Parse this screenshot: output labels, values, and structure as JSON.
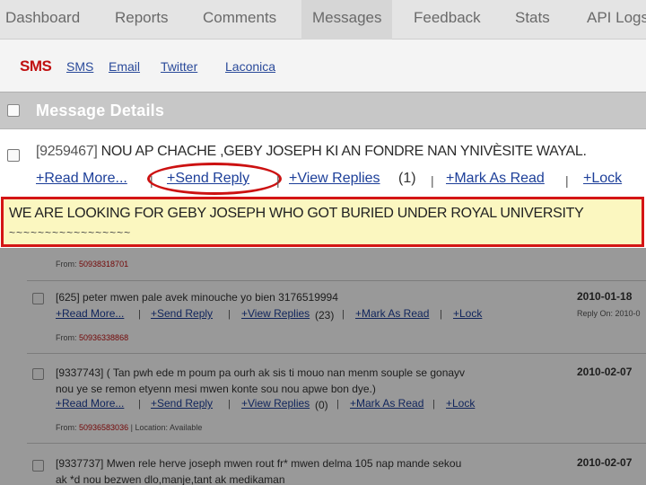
{
  "topnav": {
    "tabs": [
      {
        "label": "Dashboard"
      },
      {
        "label": "Reports"
      },
      {
        "label": "Comments"
      },
      {
        "label": "Messages",
        "active": true
      },
      {
        "label": "Feedback"
      },
      {
        "label": "Stats"
      },
      {
        "label": "API Logs"
      }
    ]
  },
  "subnav": {
    "current": "SMS",
    "links": [
      "SMS",
      "Email",
      "Twitter",
      "Laconica"
    ]
  },
  "panel": {
    "title": "Message Details"
  },
  "highlighted_message": {
    "id": "[9259467]",
    "text": "NOU AP CHACHE ,GEBY JOSEPH KI AN FONDRE NAN YNIVÈSITE WAYAL.",
    "actions": {
      "read_more": "+Read More...",
      "send_reply": "+Send Reply",
      "view_replies": "+View Replies",
      "reply_count": "(1)",
      "mark_as_read": "+Mark As Read",
      "lock": "+Lock"
    },
    "separator": "|"
  },
  "translation": {
    "line1": "WE ARE LOOKING FOR GEBY JOSEPH WHO GOT BURIED UNDER ROYAL UNIVERSITY",
    "line2": "~~~~~~~~~~~~~~~~~"
  },
  "messages": [
    {
      "from_label": "From:",
      "from": "50938318701"
    },
    {
      "text": "[625] peter mwen pale avek minouche yo bien 3176519994",
      "date": "2010-01-18",
      "reply_on": "Reply On: 2010-0",
      "read_more": "+Read More...",
      "send_reply": "+Send Reply",
      "view_replies": "+View Replies",
      "reply_count": "(23)",
      "mark_as_read": "+Mark As Read",
      "lock": "+Lock",
      "from_label": "From:",
      "from": "50936338868"
    },
    {
      "text1": "[9337743] ( Tan pwh ede m poum pa ourh ak sis ti mouo nan menm souple se gonayv",
      "text2": "nou ye se remon etyenn mesi mwen konte sou nou apwe bon dye.)",
      "date": "2010-02-07",
      "read_more": "+Read More...",
      "send_reply": "+Send Reply",
      "view_replies": "+View Replies",
      "reply_count": "(0)",
      "mark_as_read": "+Mark As Read",
      "lock": "+Lock",
      "from_label": "From:",
      "from": "50936583036",
      "location": "Location: Available"
    },
    {
      "text1": "[9337737] Mwen rele herve joseph mwen rout fr* mwen delma 105 nap mande sekou",
      "text2": "ak *d nou bezwen dlo,manje,tant ak medikaman",
      "date": "2010-02-07"
    }
  ],
  "colors": {
    "accent_red": "#cc1111",
    "link_blue": "#1d3f99",
    "highlight_yellow": "#fbf7c0"
  }
}
